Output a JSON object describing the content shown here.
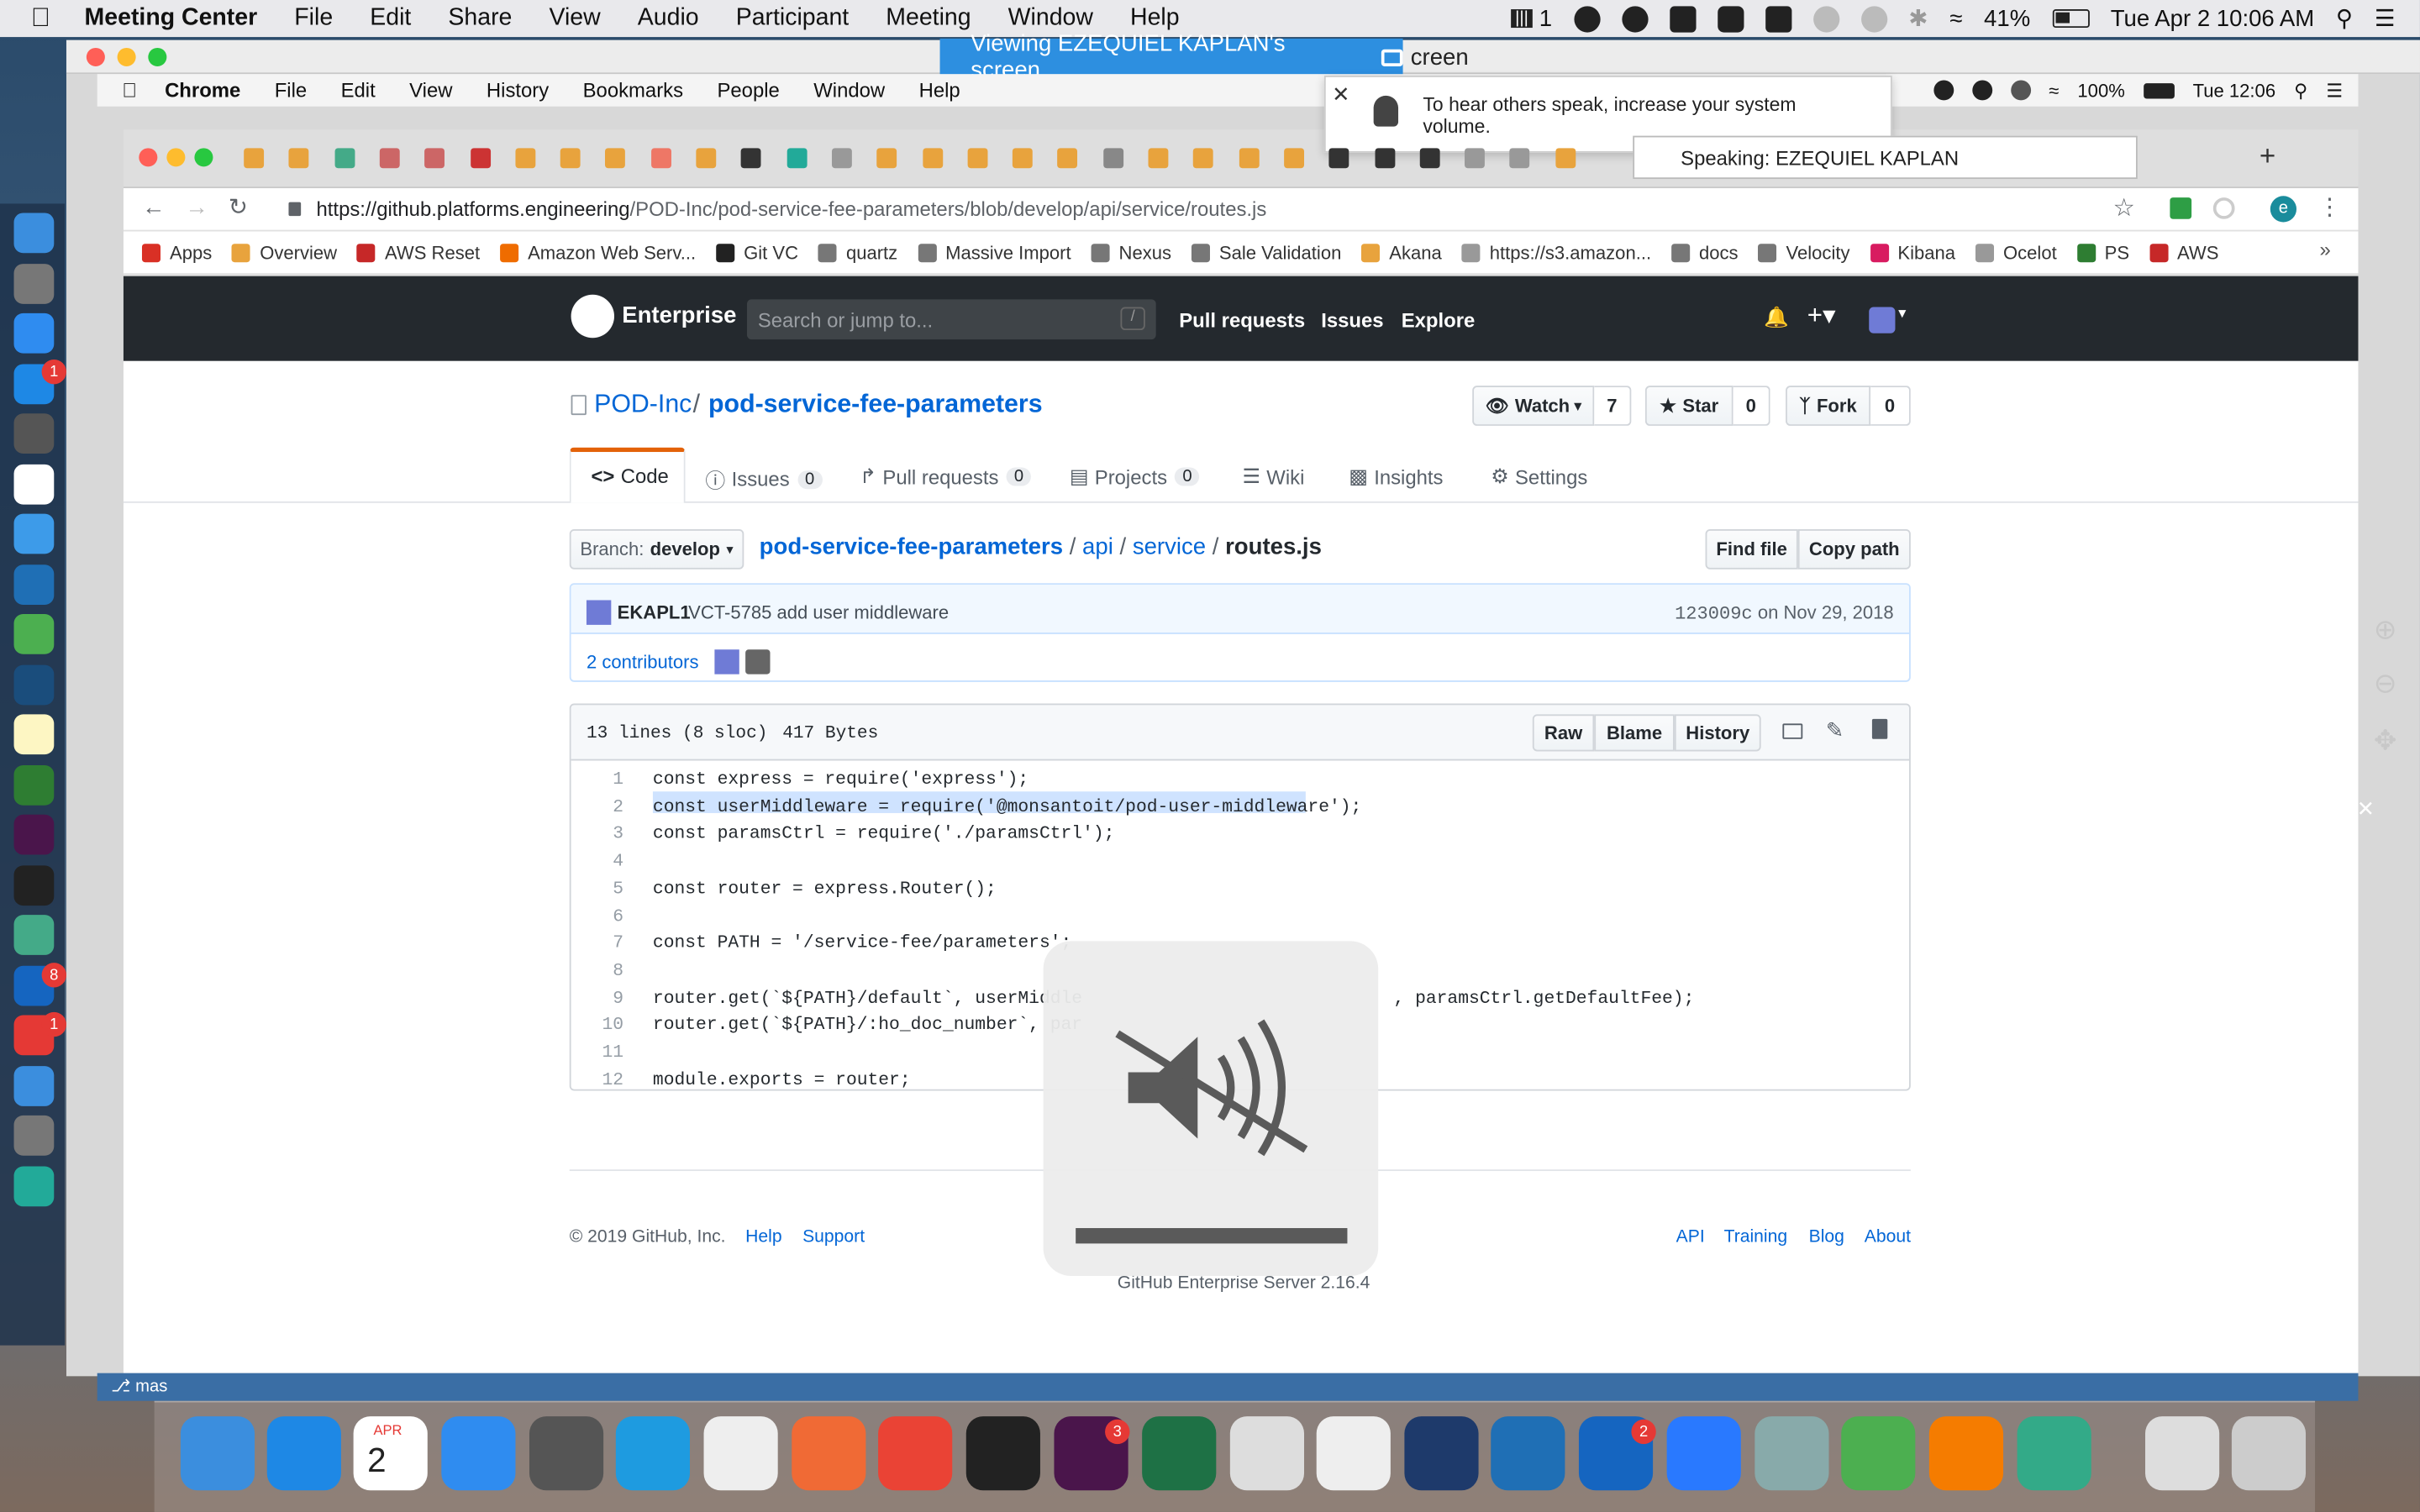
{
  "host_menubar": {
    "app": "Meeting Center",
    "items": [
      "File",
      "Edit",
      "Share",
      "View",
      "Audio",
      "Participant",
      "Meeting",
      "Window",
      "Help"
    ],
    "battery": "41%",
    "datetime": "Tue Apr 2  10:06 AM",
    "notif_count": "1"
  },
  "viewing_banner": {
    "text": "Viewing EZEQUIEL KAPLAN's screen",
    "tail": "creen"
  },
  "remote_menubar": {
    "app": "Chrome",
    "items": [
      "File",
      "Edit",
      "View",
      "History",
      "Bookmarks",
      "People",
      "Window",
      "Help"
    ],
    "battery": "100%",
    "time": "Tue 12:06"
  },
  "popup": {
    "text": "To hear others speak, increase your system volume.",
    "speaking": "Speaking: EZEQUIEL KAPLAN"
  },
  "address": {
    "host": "https://github.platforms.engineering",
    "path": "/POD-Inc/pod-service-fee-parameters/blob/develop/api/service/routes.js",
    "avatar_letter": "e"
  },
  "bookmarks": [
    {
      "label": "Apps",
      "color": "#d93025"
    },
    {
      "label": "Overview",
      "color": "#e8a33d"
    },
    {
      "label": "AWS Reset",
      "color": "#c62828"
    },
    {
      "label": "Amazon Web Serv...",
      "color": "#ef6c00"
    },
    {
      "label": "Git VC",
      "color": "#222"
    },
    {
      "label": "quartz",
      "color": "#777"
    },
    {
      "label": "Massive Import",
      "color": "#777"
    },
    {
      "label": "Nexus",
      "color": "#777"
    },
    {
      "label": "Sale Validation",
      "color": "#777"
    },
    {
      "label": "Akana",
      "color": "#e8a33d"
    },
    {
      "label": "https://s3.amazon...",
      "color": "#999"
    },
    {
      "label": "docs",
      "color": "#777"
    },
    {
      "label": "Velocity",
      "color": "#777"
    },
    {
      "label": "Kibana",
      "color": "#d81b60"
    },
    {
      "label": "Ocelot",
      "color": "#999"
    },
    {
      "label": "PS",
      "color": "#2e7d32"
    },
    {
      "label": "AWS",
      "color": "#c62828"
    }
  ],
  "gh_header": {
    "brand": "Enterprise",
    "search_placeholder": "Search or jump to...",
    "search_key": "/",
    "nav": [
      "Pull requests",
      "Issues",
      "Explore"
    ]
  },
  "repo": {
    "owner": "POD-Inc",
    "name": "pod-service-fee-parameters",
    "watch": "Watch",
    "watch_count": "7",
    "star": "Star",
    "star_count": "0",
    "fork": "Fork",
    "fork_count": "0"
  },
  "tabs": [
    {
      "label": "Code",
      "count": ""
    },
    {
      "label": "Issues",
      "count": "0"
    },
    {
      "label": "Pull requests",
      "count": "0"
    },
    {
      "label": "Projects",
      "count": "0"
    },
    {
      "label": "Wiki",
      "count": ""
    },
    {
      "label": "Insights",
      "count": ""
    },
    {
      "label": "Settings",
      "count": ""
    }
  ],
  "file": {
    "branch_label": "Branch:",
    "branch": "develop",
    "crumbs": [
      "pod-service-fee-parameters",
      "api",
      "service"
    ],
    "filename": "routes.js",
    "find_file": "Find file",
    "copy_path": "Copy path"
  },
  "commit": {
    "author": "EKAPL1",
    "message": "VCT-5785 add user middleware",
    "sha": "123009c",
    "date_prefix": "on",
    "date": "Nov 29, 2018",
    "contributors": "2 contributors"
  },
  "file_info": {
    "lines": "13 lines (8 sloc)",
    "size": "417 Bytes",
    "raw": "Raw",
    "blame": "Blame",
    "history": "History"
  },
  "code_lines": [
    "const express = require('express');",
    "const userMiddleware = require('@monsantoit/pod-user-middleware');",
    "const paramsCtrl = require('./paramsCtrl');",
    "",
    "const router = express.Router();",
    "",
    "const PATH = '/service-fee/parameters';",
    "",
    "router.get(`${PATH}/default`, userMiddle",
    "router.get(`${PATH}/:ho_doc_number`, par",
    "",
    "module.exports = router;"
  ],
  "code_line9_tail": ", paramsCtrl.getDefaultFee);",
  "footer": {
    "copyright": "© 2019 GitHub, Inc.",
    "left": [
      "Help",
      "Support"
    ],
    "right": [
      "API",
      "Training",
      "Blog",
      "About"
    ],
    "server": "GitHub Enterprise Server 2.16.4"
  },
  "hud": {
    "volume_level": 0
  },
  "dock_badges": {
    "slack": "3",
    "outlook": "2",
    "left_appstore": "1",
    "left_outlook": "8",
    "left_other": "1",
    "calendar_day": "2",
    "calendar_month": "APR"
  },
  "colors": {
    "accent": "#2d8fe0",
    "gh_header": "#24292e",
    "link": "#0366d6",
    "highlight": "#cfe3ff"
  }
}
